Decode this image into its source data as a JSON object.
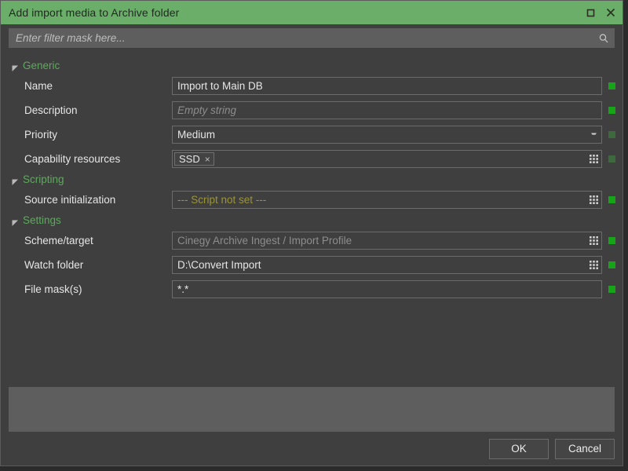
{
  "window": {
    "title": "Add import media to Archive folder",
    "controls": [
      {
        "name": "maximize-button",
        "icon": "maximize-icon"
      },
      {
        "name": "close-button",
        "icon": "close-icon"
      }
    ],
    "colors": {
      "titlebar": "#6aae6a",
      "body": "#3f3f3f",
      "group_label": "#5fa85f",
      "status_on": "#16a516",
      "status_dim": "#3d6a3d",
      "script_text": "#9c9436",
      "panel": "#5e5e5e"
    }
  },
  "filter": {
    "placeholder": "Enter filter mask here...",
    "value": "",
    "icon": "search-icon"
  },
  "groups": [
    {
      "label": "Generic",
      "expanded": true,
      "rows": [
        {
          "label": "Name",
          "value": "Import to Main DB",
          "style": "normal",
          "editor": "text",
          "button": null,
          "status": "on"
        },
        {
          "label": "Description",
          "value": "Empty string",
          "style": "placeholder",
          "editor": "text",
          "button": null,
          "status": "on"
        },
        {
          "label": "Priority",
          "value": "Medium",
          "style": "normal",
          "editor": "combo",
          "button": "dropdown-icon",
          "status": "dim"
        },
        {
          "label": "Capability resources",
          "value": "SSD",
          "style": "chip",
          "chip_remove": "×",
          "editor": "tags",
          "button": "grid-dots-icon",
          "status": "dim"
        }
      ]
    },
    {
      "label": "Scripting",
      "expanded": true,
      "rows": [
        {
          "label": "Source initialization",
          "value": "--- Script not set ---",
          "style": "script",
          "editor": "text",
          "button": "grid-dots-icon",
          "status": "on"
        }
      ]
    },
    {
      "label": "Settings",
      "expanded": true,
      "rows": [
        {
          "label": "Scheme/target",
          "value": "Cinegy Archive Ingest / Import Profile",
          "style": "muted",
          "editor": "text",
          "button": "grid-dots-icon",
          "status": "on"
        },
        {
          "label": "Watch folder",
          "value": "D:\\Convert Import",
          "style": "normal",
          "editor": "text",
          "button": "grid-dots-icon",
          "status": "on"
        },
        {
          "label": "File mask(s)",
          "value": "*.*",
          "style": "normal",
          "editor": "text",
          "button": null,
          "status": "on"
        }
      ]
    }
  ],
  "buttons": {
    "ok": "OK",
    "cancel": "Cancel"
  }
}
